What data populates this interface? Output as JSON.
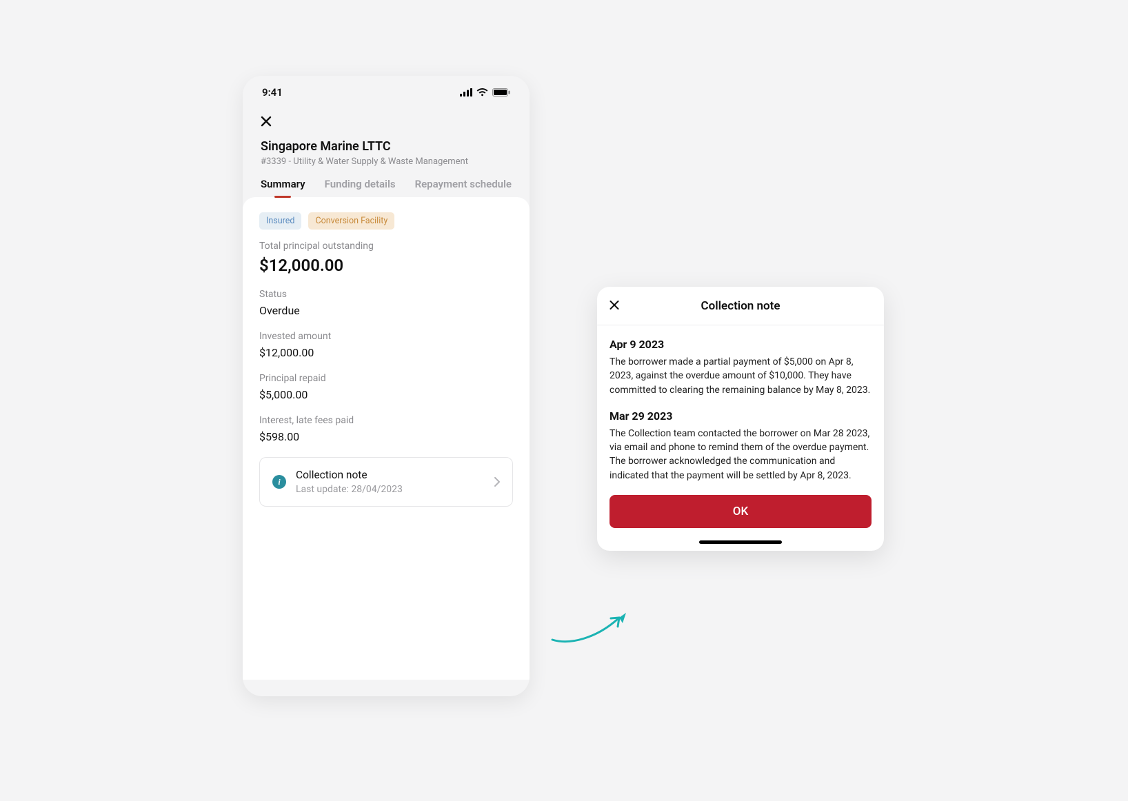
{
  "statusbar": {
    "time": "9:41"
  },
  "header": {
    "company": "Singapore Marine LTTC",
    "subtitle": "#3339 - Utility & Water Supply & Waste Management"
  },
  "tabs": [
    {
      "label": "Summary",
      "active": true
    },
    {
      "label": "Funding details",
      "active": false
    },
    {
      "label": "Repayment schedule",
      "active": false
    }
  ],
  "badges": {
    "insured": "Insured",
    "conversion": "Conversion Facility"
  },
  "summary": {
    "total_label": "Total principal outstanding",
    "total_value": "$12,000.00",
    "status_label": "Status",
    "status_value": "Overdue",
    "invested_label": "Invested amount",
    "invested_value": "$12,000.00",
    "repaid_label": "Principal repaid",
    "repaid_value": "$5,000.00",
    "interest_label": "Interest, late fees paid",
    "interest_value": "$598.00"
  },
  "note_button": {
    "title": "Collection note",
    "subtitle": "Last update: 28/04/2023"
  },
  "dialog": {
    "title": "Collection note",
    "entries": [
      {
        "date": "Apr 9 2023",
        "body": "The borrower made a partial payment of $5,000 on Apr 8, 2023, against the overdue amount of $10,000. They have committed to clearing the remaining balance by May 8, 2023."
      },
      {
        "date": "Mar 29 2023",
        "body": "The Collection team contacted the borrower on Mar 28 2023, via email and phone to remind them of the overdue payment. The borrower acknowledged the communication and indicated that the payment will be settled by Apr 8, 2023."
      }
    ],
    "ok_label": "OK"
  }
}
